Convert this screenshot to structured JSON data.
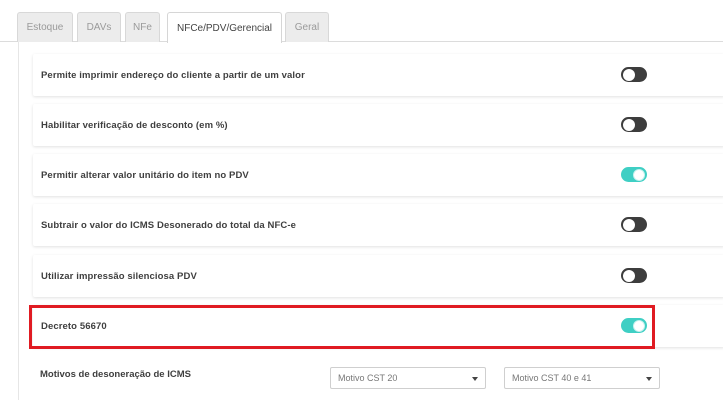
{
  "tabs": [
    {
      "label": "Estoque",
      "active": false
    },
    {
      "label": "DAVs",
      "active": false
    },
    {
      "label": "NFe",
      "active": false
    },
    {
      "label": "NFCe/PDV/Gerencial",
      "active": true
    },
    {
      "label": "Geral",
      "active": false
    }
  ],
  "settings": [
    {
      "label": "Permite imprimir endereço do cliente a partir de um valor",
      "enabled": false
    },
    {
      "label": "Habilitar verificação de desconto (em %)",
      "enabled": false
    },
    {
      "label": "Permitir alterar valor unitário do item no PDV",
      "enabled": true
    },
    {
      "label": "Subtrair o valor do ICMS Desonerado do total da NFC-e",
      "enabled": false
    },
    {
      "label": "Utilizar impressão silenciosa PDV",
      "enabled": false
    },
    {
      "label": "Decreto 56670",
      "enabled": true
    }
  ],
  "motivos": {
    "label": "Motivos de desoneração de ICMS",
    "select_cst20": "Motivo CST 20",
    "select_cst40": "Motivo CST 40 e 41"
  },
  "colors": {
    "toggle_on": "#3fcfc4",
    "toggle_off": "#3d3d3d",
    "highlight": "#e01b22"
  }
}
